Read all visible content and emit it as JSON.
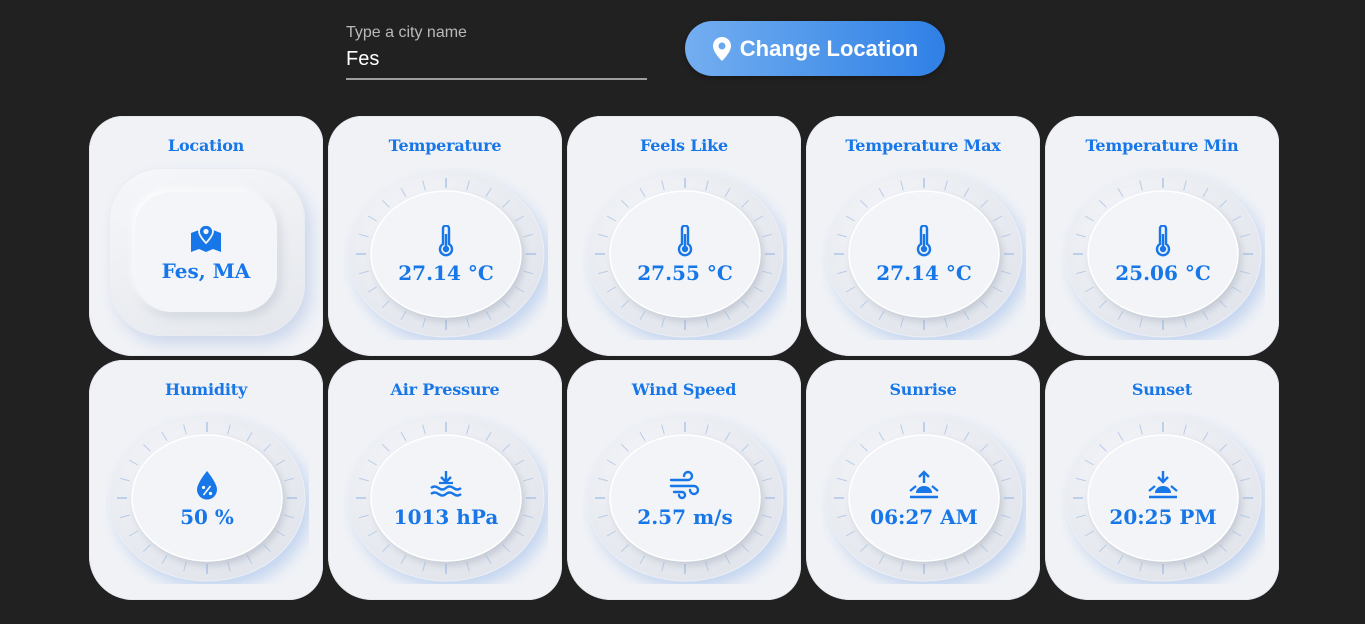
{
  "search": {
    "label": "Type a city name",
    "value": "Fes"
  },
  "change_button": {
    "label": "Change Location",
    "icon": "map-pin-icon"
  },
  "accent_color": "#1877e8",
  "cards": [
    {
      "title": "Location",
      "value": "Fes, MA",
      "icon": "map-location-icon"
    },
    {
      "title": "Temperature",
      "value": "27.14 °C",
      "icon": "thermometer-icon"
    },
    {
      "title": "Feels Like",
      "value": "27.55 °C",
      "icon": "thermometer-icon"
    },
    {
      "title": "Temperature Max",
      "value": "27.14 °C",
      "icon": "thermometer-icon"
    },
    {
      "title": "Temperature Min",
      "value": "25.06 °C",
      "icon": "thermometer-icon"
    },
    {
      "title": "Humidity",
      "value": "50 %",
      "icon": "humidity-drop-icon"
    },
    {
      "title": "Air Pressure",
      "value": "1013 hPa",
      "icon": "water-pressure-icon"
    },
    {
      "title": "Wind Speed",
      "value": "2.57 m/s",
      "icon": "wind-icon"
    },
    {
      "title": "Sunrise",
      "value": "06:27 AM",
      "icon": "sunrise-icon"
    },
    {
      "title": "Sunset",
      "value": "20:25 PM",
      "icon": "sunset-icon"
    }
  ]
}
